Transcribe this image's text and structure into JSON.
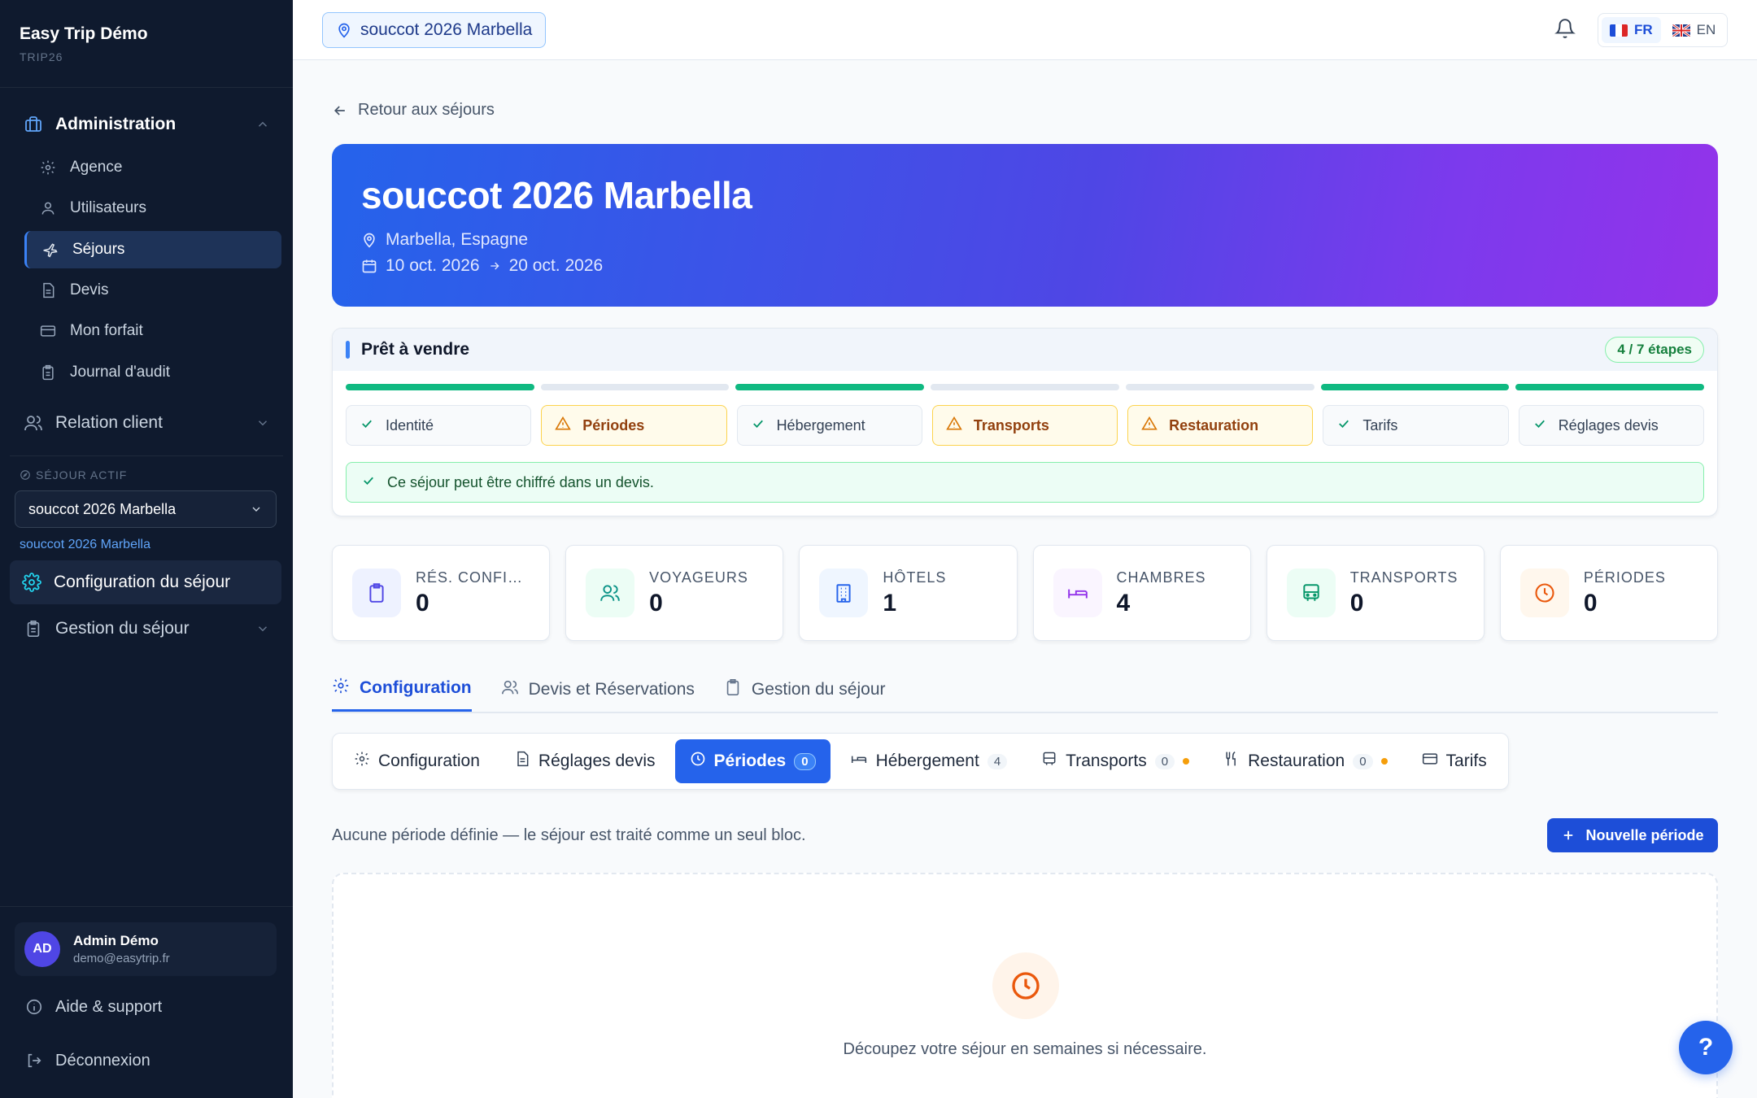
{
  "brand": {
    "title": "Easy Trip Démo",
    "code": "TRIP26"
  },
  "sidebar": {
    "admin_label": "Administration",
    "items": [
      {
        "label": "Agence",
        "icon": "gear-icon"
      },
      {
        "label": "Utilisateurs",
        "icon": "user-icon"
      },
      {
        "label": "Séjours",
        "icon": "plane-icon"
      },
      {
        "label": "Devis",
        "icon": "document-icon"
      },
      {
        "label": "Mon forfait",
        "icon": "card-icon"
      },
      {
        "label": "Journal d'audit",
        "icon": "clipboard-icon"
      }
    ],
    "relation_label": "Relation client",
    "active_trip_label": "SÉJOUR ACTIF",
    "active_trip_value": "souccot 2026 Marbella",
    "active_trip_link": "souccot 2026 Marbella",
    "config_label": "Configuration du séjour",
    "gestion_label": "Gestion du séjour",
    "user": {
      "initials": "AD",
      "name": "Admin Démo",
      "email": "demo@easytrip.fr"
    },
    "help_label": "Aide & support",
    "logout_label": "Déconnexion"
  },
  "topbar": {
    "trip": "souccot 2026 Marbella",
    "lang_fr": "FR",
    "lang_en": "EN"
  },
  "main": {
    "back_label": "Retour aux séjours",
    "hero": {
      "title": "souccot 2026 Marbella",
      "location": "Marbella, Espagne",
      "date_start": "10 oct. 2026",
      "date_end": "20 oct. 2026"
    },
    "status": {
      "title": "Prêt à vendre",
      "badge": "4 / 7 étapes",
      "progress": [
        true,
        false,
        true,
        false,
        false,
        true,
        true
      ],
      "steps": [
        {
          "label": "Identité",
          "state": "ok"
        },
        {
          "label": "Périodes",
          "state": "warn"
        },
        {
          "label": "Hébergement",
          "state": "ok"
        },
        {
          "label": "Transports",
          "state": "warn"
        },
        {
          "label": "Restauration",
          "state": "warn"
        },
        {
          "label": "Tarifs",
          "state": "ok"
        },
        {
          "label": "Réglages devis",
          "state": "ok"
        }
      ],
      "banner": "Ce séjour peut être chiffré dans un devis."
    },
    "stats": [
      {
        "label": "RÉS. CONFIR...",
        "value": "0"
      },
      {
        "label": "VOYAGEURS",
        "value": "0"
      },
      {
        "label": "HÔTELS",
        "value": "1"
      },
      {
        "label": "CHAMBRES",
        "value": "4"
      },
      {
        "label": "TRANSPORTS",
        "value": "0"
      },
      {
        "label": "PÉRIODES",
        "value": "0"
      }
    ],
    "tabs": [
      "Configuration",
      "Devis et Réservations",
      "Gestion du séjour"
    ],
    "subtabs": [
      {
        "label": "Configuration"
      },
      {
        "label": "Réglages devis"
      },
      {
        "label": "Périodes",
        "count": "0"
      },
      {
        "label": "Hébergement",
        "count": "4"
      },
      {
        "label": "Transports",
        "count": "0"
      },
      {
        "label": "Restauration",
        "count": "0"
      },
      {
        "label": "Tarifs"
      }
    ],
    "info": "Aucune période définie — le séjour est traité comme un seul bloc.",
    "new_button": "Nouvelle période",
    "empty_text": "Découpez votre séjour en semaines si nécessaire."
  },
  "help_button": "?",
  "colors": {
    "accent": "#2563eb",
    "success": "#10b981",
    "warning": "#f59e0b",
    "sidebar": "#0f1a2e"
  }
}
